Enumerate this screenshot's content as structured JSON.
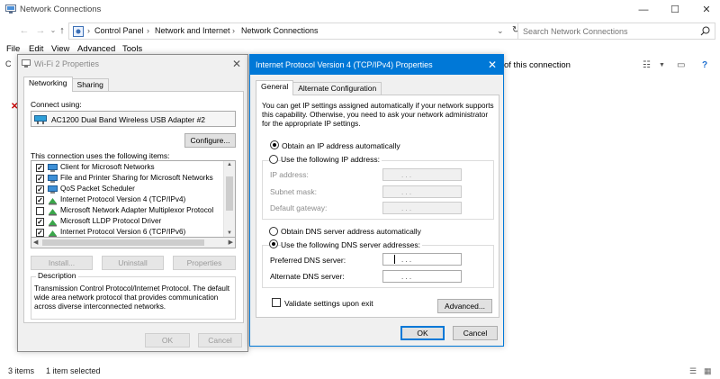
{
  "window": {
    "title": "Network Connections",
    "minimize": "—",
    "maximize": "☐",
    "close": "✕"
  },
  "address": {
    "crumbs": [
      "Control Panel",
      "Network and Internet",
      "Network Connections"
    ],
    "search_placeholder": "Search Network Connections"
  },
  "menu": [
    "File",
    "Edit",
    "View",
    "Advanced",
    "Tools"
  ],
  "right_pane_text": "of this connection",
  "left_stub": "C",
  "statusbar": {
    "items_count": "3 items",
    "selected": "1 item selected"
  },
  "wifi_dialog": {
    "title": "Wi-Fi 2 Properties",
    "tabs": [
      "Networking",
      "Sharing"
    ],
    "connect_using_label": "Connect using:",
    "adapter_name": "AC1200  Dual Band Wireless USB Adapter #2",
    "configure_button": "Configure...",
    "items_label": "This connection uses the following items:",
    "items": [
      {
        "label": "Client for Microsoft Networks",
        "checked": true,
        "icon": "network-client-icon"
      },
      {
        "label": "File and Printer Sharing for Microsoft Networks",
        "checked": true,
        "icon": "network-client-icon"
      },
      {
        "label": "QoS Packet Scheduler",
        "checked": true,
        "icon": "network-client-icon"
      },
      {
        "label": "Internet Protocol Version 4 (TCP/IPv4)",
        "checked": true,
        "icon": "protocol-icon"
      },
      {
        "label": "Microsoft Network Adapter Multiplexor Protocol",
        "checked": false,
        "icon": "protocol-icon"
      },
      {
        "label": "Microsoft LLDP Protocol Driver",
        "checked": true,
        "icon": "protocol-icon"
      },
      {
        "label": "Internet Protocol Version 6 (TCP/IPv6)",
        "checked": true,
        "icon": "protocol-icon"
      }
    ],
    "install_button": "Install...",
    "uninstall_button": "Uninstall",
    "properties_button": "Properties",
    "description_legend": "Description",
    "description_text": "Transmission Control Protocol/Internet Protocol. The default wide area network protocol that provides communication across diverse interconnected networks.",
    "ok_button": "OK",
    "cancel_button": "Cancel"
  },
  "ipv4_dialog": {
    "title": "Internet Protocol Version 4 (TCP/IPv4) Properties",
    "tabs": [
      "General",
      "Alternate Configuration"
    ],
    "intro_text": "You can get IP settings assigned automatically if your network supports this capability. Otherwise, you need to ask your network administrator for the appropriate IP settings.",
    "obtain_ip_auto": "Obtain an IP address automatically",
    "use_following_ip": "Use the following IP address:",
    "ip_address_label": "IP address:",
    "subnet_mask_label": "Subnet mask:",
    "default_gateway_label": "Default gateway:",
    "obtain_dns_auto": "Obtain DNS server address automatically",
    "use_following_dns": "Use the following DNS server addresses:",
    "preferred_dns_label": "Preferred DNS server:",
    "alternate_dns_label": "Alternate DNS server:",
    "ip_dots": ".       .       .",
    "validate_label": "Validate settings upon exit",
    "advanced_button": "Advanced...",
    "ok_button": "OK",
    "cancel_button": "Cancel",
    "ip_mode": "auto",
    "dns_mode": "manual",
    "validate_checked": false
  },
  "colors": {
    "accent": "#0078d7",
    "dialog_bg": "#f0f0f0",
    "title_active_bg": "#0078d7"
  }
}
